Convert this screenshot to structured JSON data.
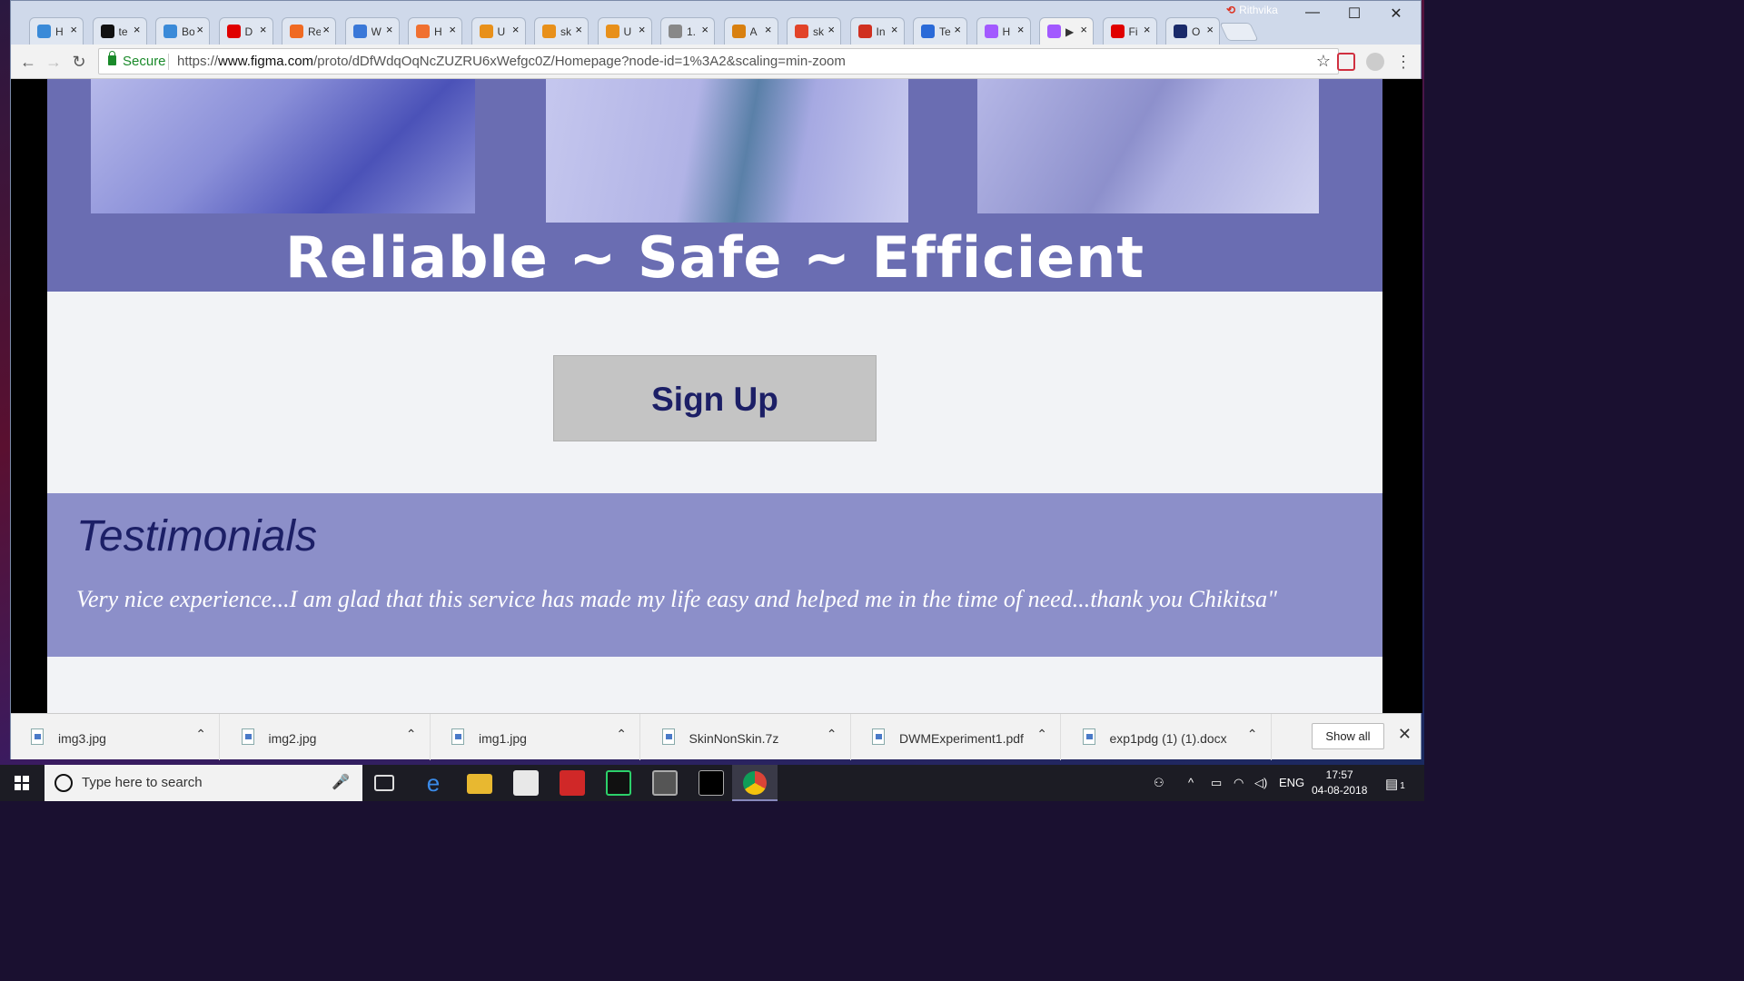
{
  "browser": {
    "profile_name": "Rithvika",
    "tabs": [
      {
        "label": "H",
        "icon": "uxpin-icon",
        "color": "#3a8ad8"
      },
      {
        "label": "te",
        "icon": "github-icon",
        "color": "#111111"
      },
      {
        "label": "Bo",
        "icon": "uxpin-icon",
        "color": "#3a8ad8"
      },
      {
        "label": "D",
        "icon": "youtube-icon",
        "color": "#e00000"
      },
      {
        "label": "Re",
        "icon": "blogger-icon",
        "color": "#f06a22"
      },
      {
        "label": "W",
        "icon": "infinity-icon",
        "color": "#3a78d8"
      },
      {
        "label": "H",
        "icon": "ring-icon",
        "color": "#f07030"
      },
      {
        "label": "U",
        "icon": "tag-icon",
        "color": "#e8901a"
      },
      {
        "label": "sk",
        "icon": "tag-icon",
        "color": "#e8901a"
      },
      {
        "label": "U",
        "icon": "tag-icon",
        "color": "#e8901a"
      },
      {
        "label": "1.",
        "icon": "page-icon",
        "color": "#888888"
      },
      {
        "label": "A",
        "icon": "angelist-icon",
        "color": "#d88010"
      },
      {
        "label": "sk",
        "icon": "gitlab-icon",
        "color": "#e24329"
      },
      {
        "label": "In",
        "icon": "gmail-icon",
        "color": "#d03020"
      },
      {
        "label": "Te",
        "icon": "docs-icon",
        "color": "#2a6ad8"
      },
      {
        "label": "H",
        "icon": "figma-icon",
        "color": "#a259ff"
      },
      {
        "label": "▶",
        "icon": "figma-icon",
        "color": "#a259ff"
      },
      {
        "label": "Fi",
        "icon": "youtube-icon",
        "color": "#e00000"
      },
      {
        "label": "O",
        "icon": "p-icon",
        "color": "#1a2a6a"
      }
    ],
    "address": {
      "secure_label": "Secure",
      "url_prefix": "https://",
      "url_host": "www.figma.com",
      "url_path": "/proto/dDfWdqOqNcZUZRU6xWefgc0Z/Homepage?node-id=1%3A2&scaling=min-zoom"
    }
  },
  "page": {
    "tagline": "Reliable ~ Safe ~ Efficient",
    "signup_label": "Sign Up",
    "testimonials_title": "Testimonials",
    "testimonial_text": "Very nice experience...I am glad that this service has made my life easy and helped me in the time of need...thank you Chikitsa\"",
    "colors": {
      "hero": "#6a6db2",
      "testimonials_bg": "#8c8fc9",
      "heading": "#1c1f66"
    }
  },
  "downloads": {
    "items": [
      {
        "name": "img3.jpg"
      },
      {
        "name": "img2.jpg"
      },
      {
        "name": "img1.jpg"
      },
      {
        "name": "SkinNonSkin.7z"
      },
      {
        "name": "DWMExperiment1.pdf"
      },
      {
        "name": "exp1pdg (1) (1).docx"
      }
    ],
    "show_all_label": "Show all"
  },
  "taskbar": {
    "search_placeholder": "Type here to search",
    "language": "ENG",
    "time": "17:57",
    "date": "04-08-2018",
    "notifications": "1"
  }
}
